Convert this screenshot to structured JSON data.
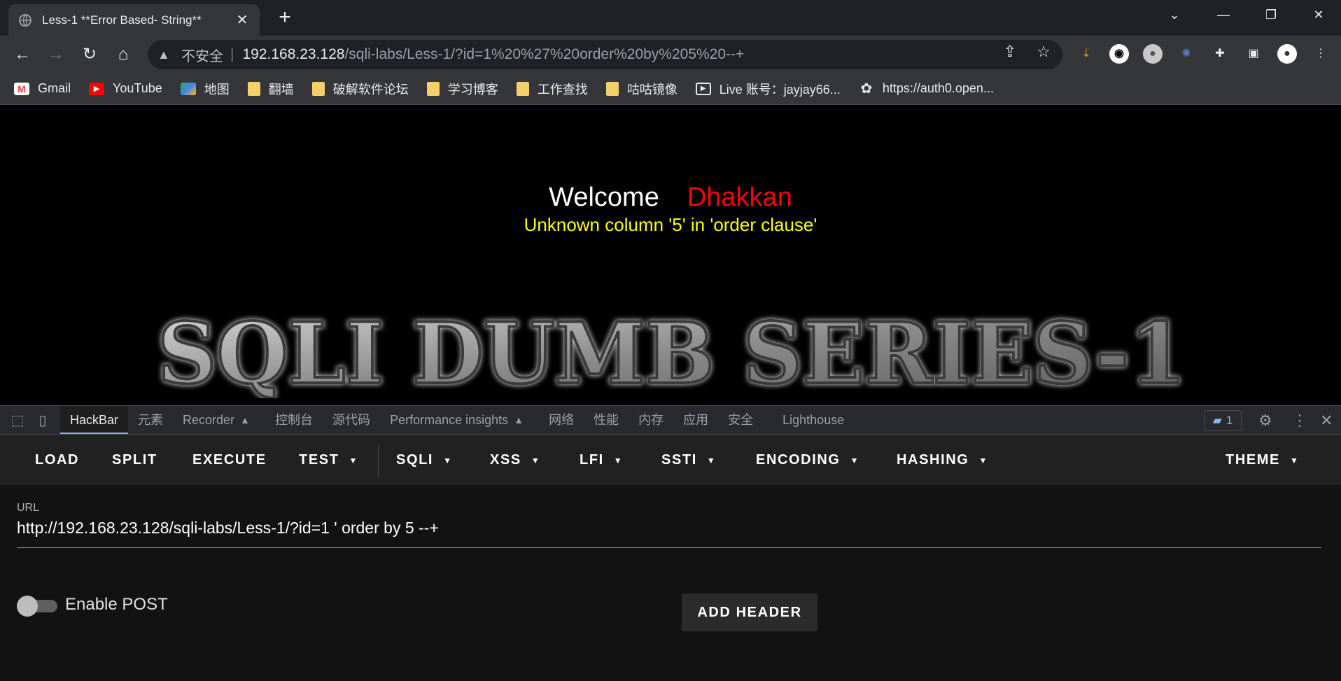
{
  "browser": {
    "tab_title": "Less-1 **Error Based- String**",
    "tab_close": "✕",
    "new_tab": "+",
    "window_controls": {
      "dropdown": "⌄",
      "minimize": "—",
      "restore": "❐",
      "close": "✕"
    },
    "omnibox": {
      "security_label": "不安全",
      "separator": "|",
      "host": "192.168.23.128",
      "path": "/sqli-labs/Less-1/?id=1%20%27%20order%20by%205%20--+"
    },
    "bookmarks": [
      {
        "label": "Gmail",
        "icon": "gmail-icon"
      },
      {
        "label": "YouTube",
        "icon": "youtube-icon"
      },
      {
        "label": "地图",
        "icon": "maps-icon"
      },
      {
        "label": "翻墙",
        "icon": "folder-icon"
      },
      {
        "label": "破解软件论坛",
        "icon": "folder-icon"
      },
      {
        "label": "学习博客",
        "icon": "folder-icon"
      },
      {
        "label": "工作查找",
        "icon": "folder-icon"
      },
      {
        "label": "咕咕镜像",
        "icon": "folder-icon"
      },
      {
        "label": "Live  账号：jayjay66...",
        "icon": "live-icon"
      },
      {
        "label": "https://auth0.open...",
        "icon": "openai-icon"
      }
    ]
  },
  "page": {
    "welcome": "Welcome",
    "user": "Dhakkan",
    "error": "Unknown column '5' in 'order clause'",
    "banner": "SQLI DUMB SERIES-1",
    "colors": {
      "welcome": "#ffffff",
      "user": "#ff0000",
      "error": "#ffff00"
    }
  },
  "devtools": {
    "tabs": [
      "HackBar",
      "元素",
      "Recorder",
      "控制台",
      "源代码",
      "Performance insights",
      "网络",
      "性能",
      "内存",
      "应用",
      "安全",
      "Lighthouse"
    ],
    "active_tab": "HackBar",
    "message_count": "1"
  },
  "hackbar": {
    "menu": {
      "load": "LOAD",
      "split": "SPLIT",
      "execute": "EXECUTE",
      "test": "TEST",
      "sqli": "SQLI",
      "xss": "XSS",
      "lfi": "LFI",
      "ssti": "SSTI",
      "encoding": "ENCODING",
      "hashing": "HASHING",
      "theme": "THEME"
    },
    "url_label": "URL",
    "url_value": "http://192.168.23.128/sqli-labs/Less-1/?id=1 ' order by 5 --+",
    "enable_post_label": "Enable POST",
    "enable_post": false,
    "add_header": "ADD HEADER"
  }
}
